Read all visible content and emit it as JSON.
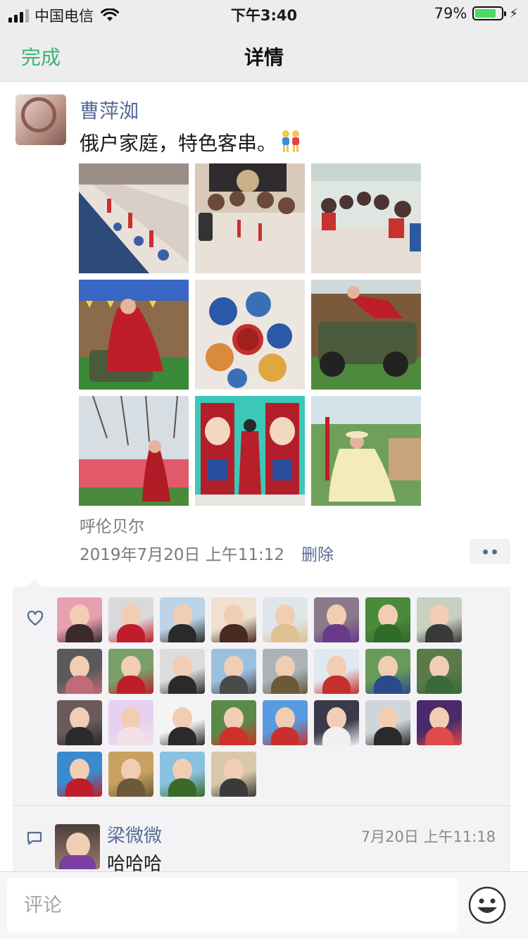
{
  "status_bar": {
    "carrier": "中国电信",
    "time": "下午3:40",
    "battery": "79%",
    "battery_level": 0.79
  },
  "nav": {
    "done_label": "完成",
    "title": "详情"
  },
  "post": {
    "author": "曹萍洳",
    "text": "俄户家庭，特色客串。",
    "location": "呼伦贝尔",
    "time": "2019年7月20日 上午11:12",
    "delete_label": "删除",
    "photo_count": 9
  },
  "likes": {
    "icon": "heart-outline-icon",
    "count": 28
  },
  "comments": [
    {
      "user": "梁微微",
      "time": "7月20日 上午11:18",
      "text": "哈哈哈"
    }
  ],
  "input": {
    "placeholder": "评论",
    "value": ""
  },
  "colors": {
    "accent_green": "#3cb371",
    "link_blue": "#576b95",
    "battery_green": "#4cd964"
  }
}
